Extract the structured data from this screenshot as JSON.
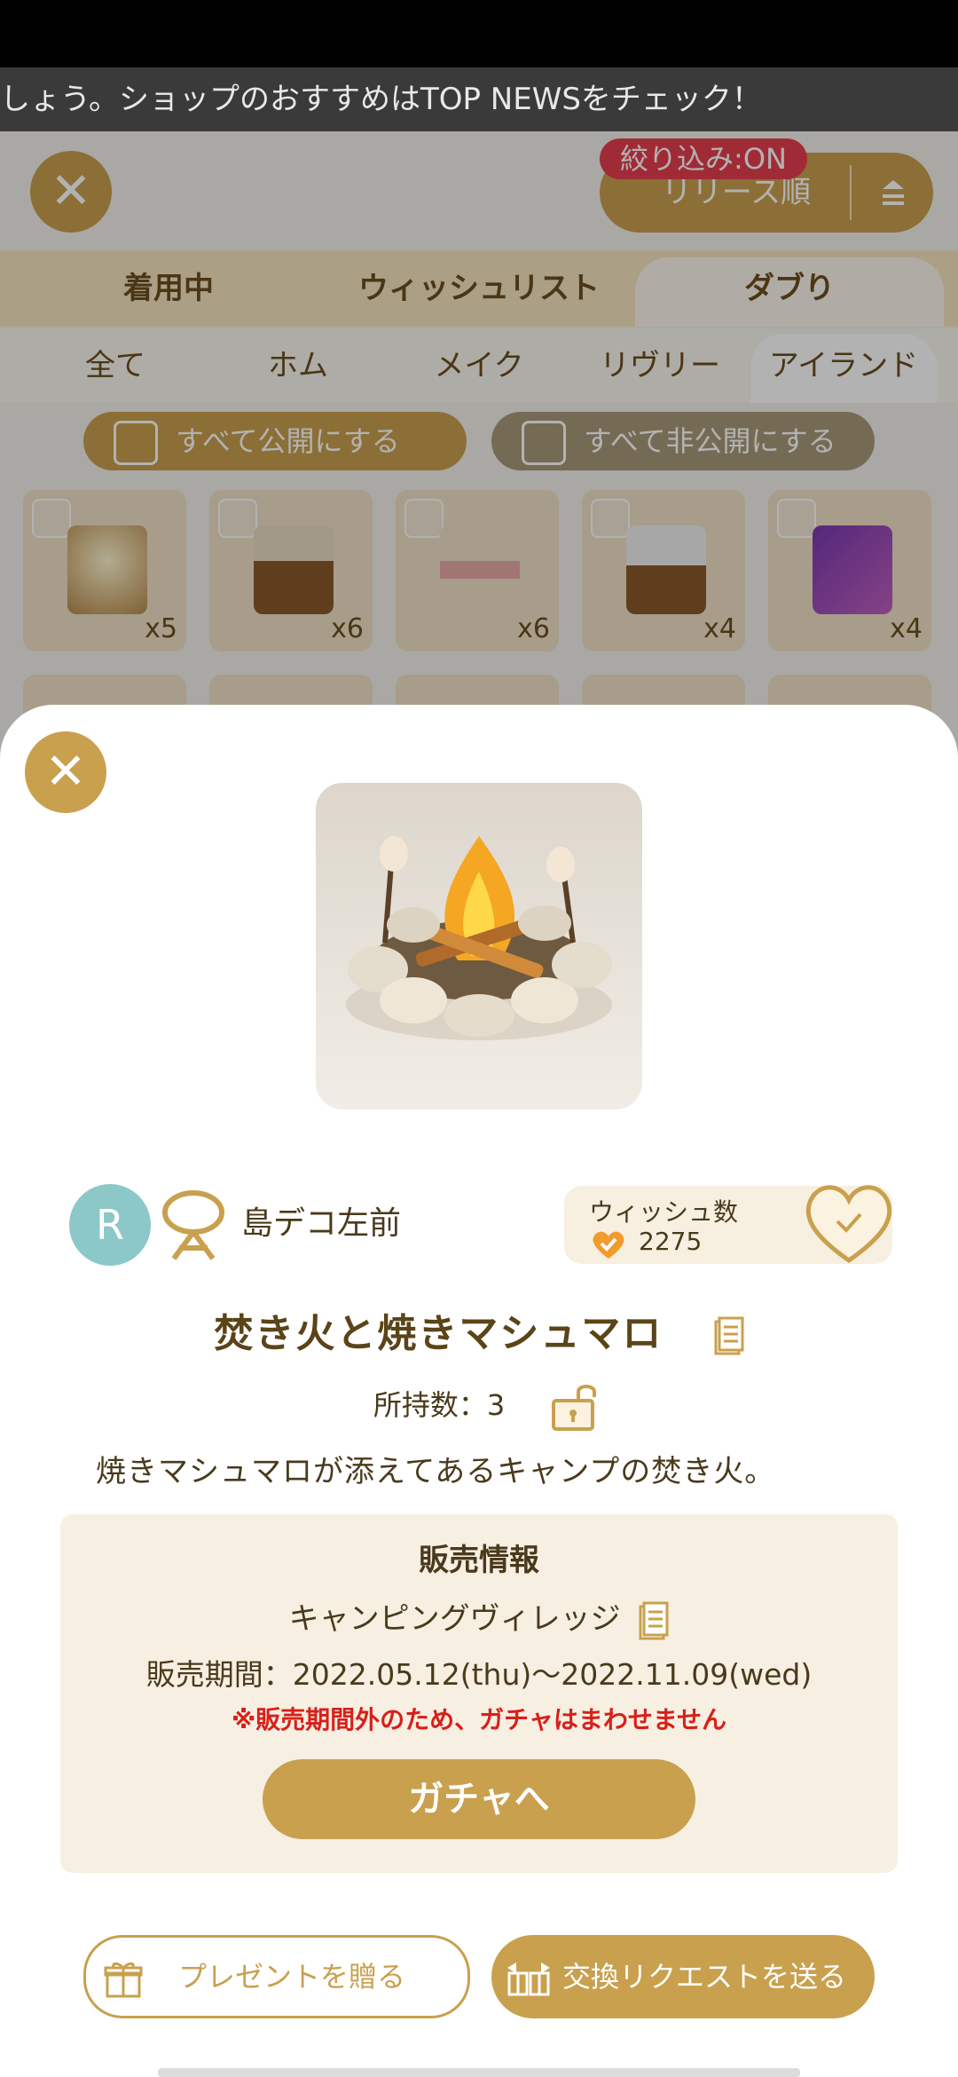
{
  "ticker": "しょう。ショップのおすすめはTOP NEWSをチェック！",
  "header": {
    "close_glyph": "✕",
    "sort_label": "リリース順",
    "filter_badge": "絞り込み:ON"
  },
  "tabs_main": [
    "着用中",
    "ウィッシュリスト",
    "ダブり"
  ],
  "tabs_category": [
    "全て",
    "ホム",
    "メイク",
    "リヴリー",
    "アイランド"
  ],
  "publish": {
    "all_public": "すべて公開にする",
    "all_private": "すべて非公開にする"
  },
  "grid": [
    {
      "count": "x5"
    },
    {
      "count": "x6"
    },
    {
      "count": "x6"
    },
    {
      "count": "x4"
    },
    {
      "count": "x4"
    }
  ],
  "item": {
    "brand_initial": "R",
    "brand_name": "島デコ左前",
    "wish_label": "ウィッシュ数",
    "wish_count": "2275",
    "name": "焚き火と焼きマシュマロ",
    "owned": "所持数：3",
    "description": "焼きマシュマロが添えてあるキャンプの焚き火。"
  },
  "sale": {
    "title": "販売情報",
    "shop": "キャンピングヴィレッジ",
    "period": "販売期間：2022.05.12(thu)〜2022.11.09(wed)",
    "warning": "※販売期間外のため、ガチャはまわせません",
    "gacha_button": "ガチャへ"
  },
  "actions": {
    "gift": "プレゼントを贈る",
    "trade": "交換リクエストを送る"
  },
  "colors": {
    "accent": "#c9a04e",
    "warning": "#d8201a",
    "avatar": "#8cc8c8"
  }
}
